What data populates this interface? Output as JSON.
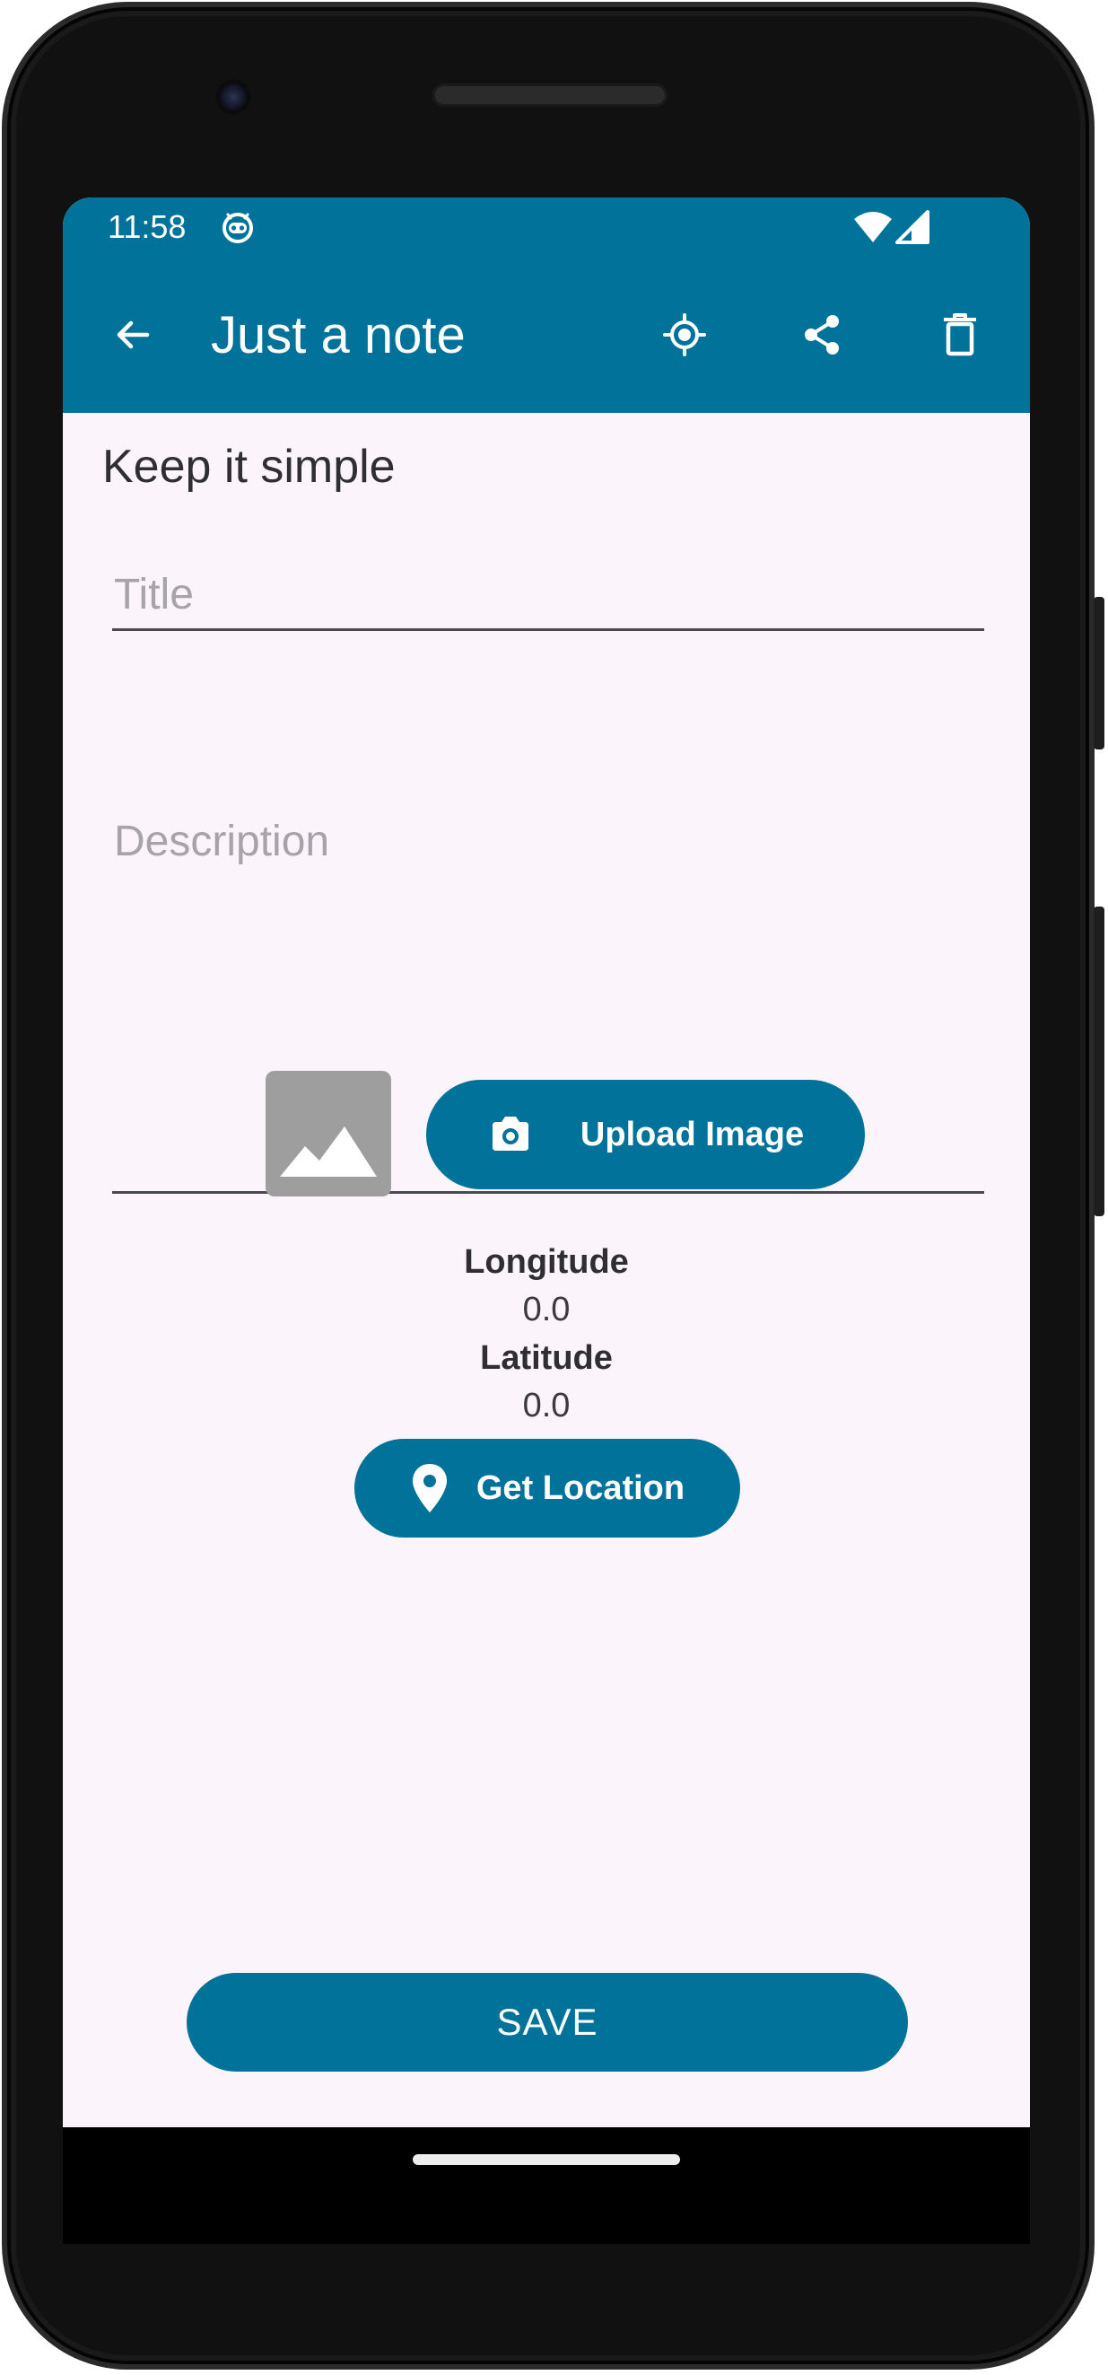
{
  "status_bar": {
    "time": "11:58",
    "icons": [
      "robot-notification-icon",
      "wifi-icon",
      "cell-signal-icon"
    ]
  },
  "app_bar": {
    "title": "Just a note",
    "back_icon": "arrow-back-icon",
    "actions": [
      "my-location-icon",
      "share-icon",
      "delete-icon"
    ]
  },
  "main": {
    "subtitle": "Keep it simple",
    "title_field": {
      "value": "",
      "placeholder": "Title"
    },
    "description_field": {
      "value": "",
      "placeholder": "Description"
    },
    "image_placeholder_icon": "image-placeholder-icon",
    "upload_button": {
      "label": "Upload Image",
      "icon": "camera-icon"
    },
    "longitude": {
      "label": "Longitude",
      "value": "0.0"
    },
    "latitude": {
      "label": "Latitude",
      "value": "0.0"
    },
    "location_button": {
      "label": "Get Location",
      "icon": "location-pin-icon"
    },
    "save_button": {
      "label": "SAVE"
    }
  },
  "colors": {
    "primary": "#01729a",
    "background": "#fbf5fb",
    "text": "#2f2f33",
    "placeholder": "#a7a3aa",
    "image_placeholder": "#9e9e9e"
  }
}
